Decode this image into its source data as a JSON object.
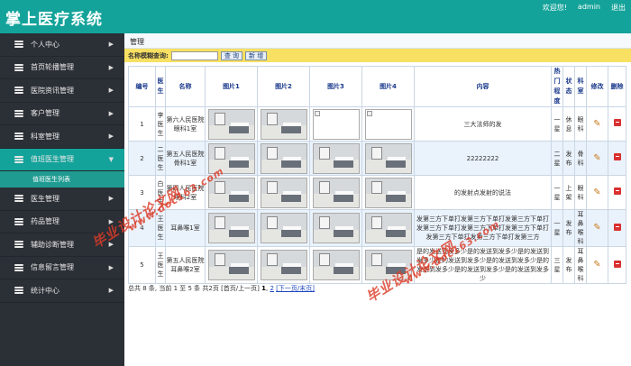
{
  "app": {
    "title": "掌上医疗系统"
  },
  "topbar": {
    "welcome": "欢迎您!",
    "user": "admin",
    "logout": "退出"
  },
  "sidebar": {
    "items": [
      {
        "label": "个人中心"
      },
      {
        "label": "首页轮播管理"
      },
      {
        "label": "医院资讯管理"
      },
      {
        "label": "客户管理"
      },
      {
        "label": "科室管理"
      },
      {
        "label": "值班医生管理"
      },
      {
        "label": "医生管理"
      },
      {
        "label": "药品管理"
      },
      {
        "label": "辅助诊断管理"
      },
      {
        "label": "信息留言管理"
      },
      {
        "label": "统计中心"
      }
    ],
    "active_sub": "值班医生列表"
  },
  "breadcrumb": "管理",
  "search": {
    "label": "名称模糊查询:",
    "value": "",
    "query_button": "查 询",
    "add_button": "新 增"
  },
  "table": {
    "headers": [
      "编号",
      "医生",
      "名称",
      "图片1",
      "图片2",
      "图片3",
      "图片4",
      "内容",
      "热门程度",
      "状态",
      "科室",
      "修改",
      "删除"
    ],
    "rows": [
      {
        "id": "1",
        "doctor": "李医生",
        "name": "第六人民医院眼科1室",
        "pics": [
          "img",
          "img",
          "broken",
          "broken"
        ],
        "content": "三大法师的发",
        "hot": "一星",
        "status": "休息",
        "dept": "眼科"
      },
      {
        "id": "2",
        "doctor": "二医生",
        "name": "第五人民医院骨科1室",
        "pics": [
          "img",
          "img",
          "img",
          "img"
        ],
        "content": "22222222",
        "hot": "二星",
        "status": "发布",
        "dept": "骨科"
      },
      {
        "id": "3",
        "doctor": "白医生",
        "name": "第四人民医院眼科2室",
        "pics": [
          "img",
          "img",
          "img",
          "img"
        ],
        "content": "的发射点发射的说法",
        "hot": "一星",
        "status": "上架",
        "dept": "眼科"
      },
      {
        "id": "4",
        "doctor": "王医生",
        "name": "耳鼻喉1室",
        "pics": [
          "img",
          "img",
          "img",
          "img"
        ],
        "content": "发第三方下单打发第三方下单打发第三方下单打发第三方下单打发第三方下单打发第三方下单打发第三方下单打发第三方下单打发第三方",
        "hot": "一星",
        "status": "发布",
        "dept": "耳鼻喉科"
      },
      {
        "id": "5",
        "doctor": "王医生",
        "name": "第五人民医院耳鼻喉2室",
        "pics": [
          "img",
          "img",
          "img",
          "img"
        ],
        "content": "是的发送到发多少是的发送到发多少是的发送到发多少是的发送到发多少是的发送到发多少是的发送到发多少是的发送到发多少是的发送到发多少",
        "hot": "三星",
        "status": "发布",
        "dept": "耳鼻喉科"
      }
    ]
  },
  "pager": {
    "summary": "总共 8 条, 当前 1 至 5 条 共2页",
    "first_prev": "[首页/上一页]",
    "p1": "1",
    "p2": "2",
    "next": "[下一页/末页]"
  },
  "watermarks": {
    "cn": "毕业设计论文网",
    "url": "www.doc163.com"
  }
}
